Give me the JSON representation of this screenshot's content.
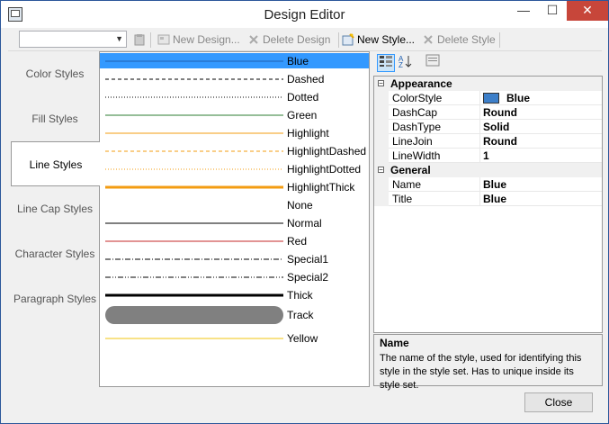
{
  "window": {
    "title": "Design Editor"
  },
  "titlebar": {
    "minimize_glyph": "—",
    "maximize_glyph": "☐",
    "close_glyph": "✕"
  },
  "toolbar": {
    "combo_value": "",
    "new_design": "New Design...",
    "delete_design": "Delete Design",
    "new_style": "New Style...",
    "delete_style": "Delete Style"
  },
  "tabs": [
    "Color Styles",
    "Fill Styles",
    "Line Styles",
    "Line Cap Styles",
    "Character Styles",
    "Paragraph Styles"
  ],
  "selected_tab": "Line Styles",
  "styles": [
    {
      "name": "Blue",
      "color": "#1f5fb0",
      "dash": "",
      "width": 1
    },
    {
      "name": "Dashed",
      "color": "#000000",
      "dash": "4 3",
      "width": 1
    },
    {
      "name": "Dotted",
      "color": "#000000",
      "dash": "1 2",
      "width": 1
    },
    {
      "name": "Green",
      "color": "#2e7d32",
      "dash": "",
      "width": 1
    },
    {
      "name": "Highlight",
      "color": "#f39c12",
      "dash": "",
      "width": 1
    },
    {
      "name": "HighlightDashed",
      "color": "#f39c12",
      "dash": "4 3",
      "width": 1
    },
    {
      "name": "HighlightDotted",
      "color": "#f39c12",
      "dash": "1 2",
      "width": 1
    },
    {
      "name": "HighlightThick",
      "color": "#f39c12",
      "dash": "",
      "width": 3
    },
    {
      "name": "None",
      "color": "none",
      "dash": "",
      "width": 0
    },
    {
      "name": "Normal",
      "color": "#000000",
      "dash": "",
      "width": 1
    },
    {
      "name": "Red",
      "color": "#c62828",
      "dash": "",
      "width": 1
    },
    {
      "name": "Special1",
      "color": "#000000",
      "dash": "6 2 1 2",
      "width": 1
    },
    {
      "name": "Special2",
      "color": "#000000",
      "dash": "6 2 1 2 1 2",
      "width": 1
    },
    {
      "name": "Thick",
      "color": "#000000",
      "dash": "",
      "width": 3
    },
    {
      "name": "Track",
      "color": "#808080",
      "dash": "",
      "width": 20
    },
    {
      "name": "Yellow",
      "color": "#f1c40f",
      "dash": "",
      "width": 1
    }
  ],
  "selected_style": "Blue",
  "property_grid": {
    "categories": [
      {
        "name": "Appearance",
        "rows": [
          {
            "name": "ColorStyle",
            "value": "Blue",
            "swatch": "#3d7fc9"
          },
          {
            "name": "DashCap",
            "value": "Round"
          },
          {
            "name": "DashType",
            "value": "Solid"
          },
          {
            "name": "LineJoin",
            "value": "Round"
          },
          {
            "name": "LineWidth",
            "value": "1"
          }
        ]
      },
      {
        "name": "General",
        "rows": [
          {
            "name": "Name",
            "value": "Blue"
          },
          {
            "name": "Title",
            "value": "Blue"
          }
        ]
      }
    ]
  },
  "description": {
    "title": "Name",
    "text": "The name of the style, used for identifying this style in the style set. Has to unique inside its style set."
  },
  "close_button": "Close",
  "colors": {
    "selection": "#3399ff",
    "accent_border": "#2b579a",
    "close_red": "#c7463a"
  }
}
